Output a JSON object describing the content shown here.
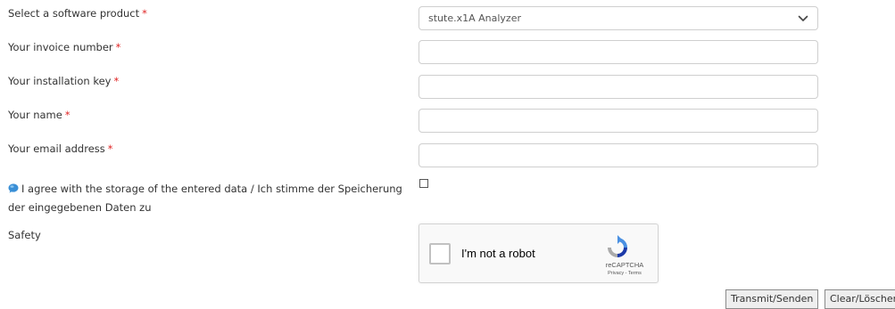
{
  "form": {
    "product": {
      "label": "Select a software product",
      "required_mark": "*",
      "selected_value": "stute.x1A Analyzer",
      "icon": "chevron-down-icon"
    },
    "invoice": {
      "label": "Your invoice number",
      "required_mark": "*",
      "value": "",
      "placeholder": ""
    },
    "installation_key": {
      "label": "Your installation key",
      "required_mark": "*",
      "value": "",
      "placeholder": ""
    },
    "name": {
      "label": "Your name",
      "required_mark": "*",
      "value": "",
      "placeholder": ""
    },
    "email": {
      "label": "Your email address",
      "required_mark": "*",
      "value": "",
      "placeholder": ""
    },
    "consent": {
      "icon": "info-icon",
      "text": "I agree with the storage of the entered data / Ich stimme der Speicherung der eingegebenen Daten zu",
      "checked": false
    },
    "safety": {
      "label": "Safety"
    }
  },
  "captcha": {
    "label": "I'm not a robot",
    "brand": "reCAPTCHA",
    "links": "Privacy - Terms",
    "icon": "recaptcha-logo-icon"
  },
  "buttons": {
    "transmit_label": "Transmit/Senden",
    "clear_label": "Clear/Löschen"
  },
  "colors": {
    "required": "#e02424",
    "text": "#333333",
    "border": "#cfcfcf",
    "captcha_blue": "#4a90e2"
  }
}
